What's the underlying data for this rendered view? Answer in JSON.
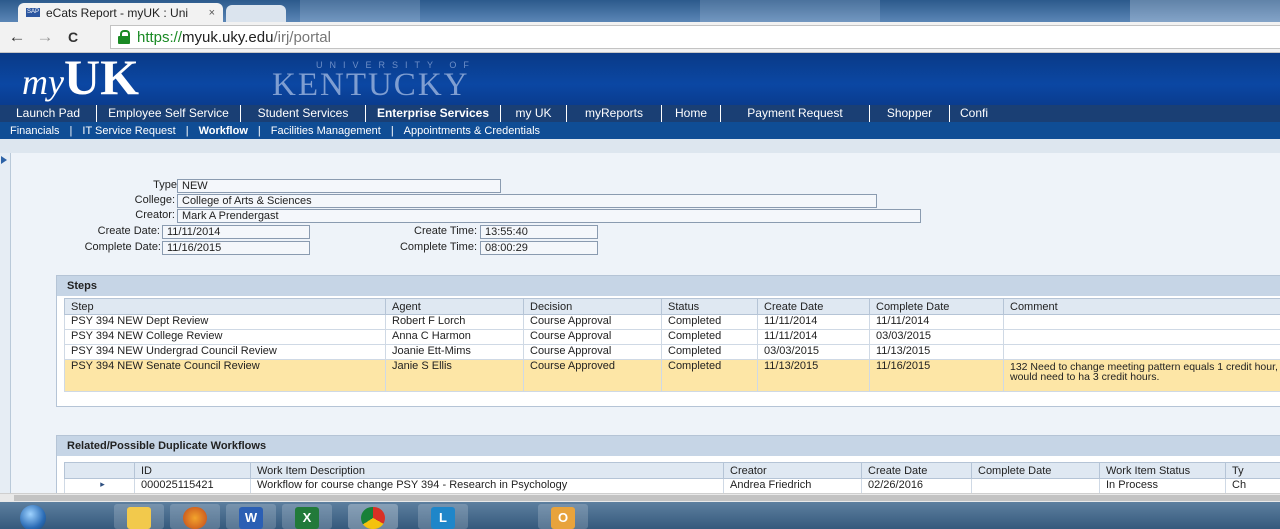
{
  "browser": {
    "tab_title": "eCats Report - myUK : Uni",
    "tab_close": "×",
    "url_scheme": "https://",
    "url_host": "myuk.uky.edu",
    "url_path": "/irj/portal",
    "back": "←",
    "forward": "→",
    "reload": "C"
  },
  "header": {
    "logo_my": "my",
    "logo_uk": "UK",
    "university_of": "UNIVERSITY OF",
    "kentucky": "KENTUCKY"
  },
  "nav": {
    "top": [
      "Launch Pad",
      "Employee Self Service",
      "Student Services",
      "Enterprise Services",
      "my UK",
      "myReports",
      "Home",
      "Payment Request",
      "Shopper",
      "Confi"
    ],
    "active_top": "Enterprise Services",
    "sub": [
      "Financials",
      "IT Service Request",
      "Workflow",
      "Facilities Management",
      "Appointments & Credentials"
    ],
    "active_sub": "Workflow",
    "sub_separator": "|"
  },
  "form": {
    "type_label": "Type:",
    "type_value": "NEW",
    "college_label": "College:",
    "college_value": "College of Arts & Sciences",
    "creator_label": "Creator:",
    "creator_value": "Mark A Prendergast",
    "create_date_label": "Create Date:",
    "create_date_value": "11/11/2014",
    "create_time_label": "Create Time:",
    "create_time_value": "13:55:40",
    "complete_date_label": "Complete Date:",
    "complete_date_value": "11/16/2015",
    "complete_time_label": "Complete Time:",
    "complete_time_value": "08:00:29"
  },
  "steps": {
    "title": "Steps",
    "columns": [
      "Step",
      "Agent",
      "Decision",
      "Status",
      "Create Date",
      "Complete Date",
      "Comment"
    ],
    "rows": [
      [
        "PSY 394 NEW Dept Review",
        "Robert F Lorch",
        "Course Approval",
        "Completed",
        "11/11/2014",
        "11/11/2014",
        ""
      ],
      [
        "PSY 394 NEW College Review",
        "Anna C Harmon",
        "Course Approval",
        "Completed",
        "11/11/2014",
        "03/03/2015",
        ""
      ],
      [
        "PSY 394 NEW Undergrad Council Review",
        "Joanie Ett-Mims",
        "Course Approval",
        "Completed",
        "03/03/2015",
        "11/13/2015",
        ""
      ],
      [
        "PSY 394 NEW Senate Council Review",
        "Janie S Ellis",
        "Course Approved",
        "Completed",
        "11/13/2015",
        "11/16/2015",
        "132  Need to change meeting pattern equals 1 credit hour, would need to ha 3 credit hours."
      ]
    ]
  },
  "duplicates": {
    "title": "Related/Possible Duplicate Workflows",
    "columns": [
      "",
      "ID",
      "Work Item Description",
      "Creator",
      "Create Date",
      "Complete Date",
      "Work Item Status",
      "Ty"
    ],
    "rows": [
      [
        "▸",
        "000025115421",
        "Workflow for course change PSY 394 - Research in Psychology",
        "Andrea Friedrich",
        "02/26/2016",
        "",
        "In Process",
        "Ch"
      ]
    ]
  },
  "taskbar": {
    "items": [
      "start-orb",
      "explorer",
      "firefox",
      "word",
      "excel",
      "chrome",
      "lync",
      "outlook"
    ],
    "word_letter": "W",
    "excel_letter": "X",
    "lync_letter": "L",
    "outlook_letter": "O"
  },
  "colors": {
    "header_blue": "#0b47a3",
    "nav_dark": "#1a3f74",
    "subnav": "#0f4d95",
    "highlight_row": "#fde6a6",
    "secure_green": "#1a8a24"
  }
}
